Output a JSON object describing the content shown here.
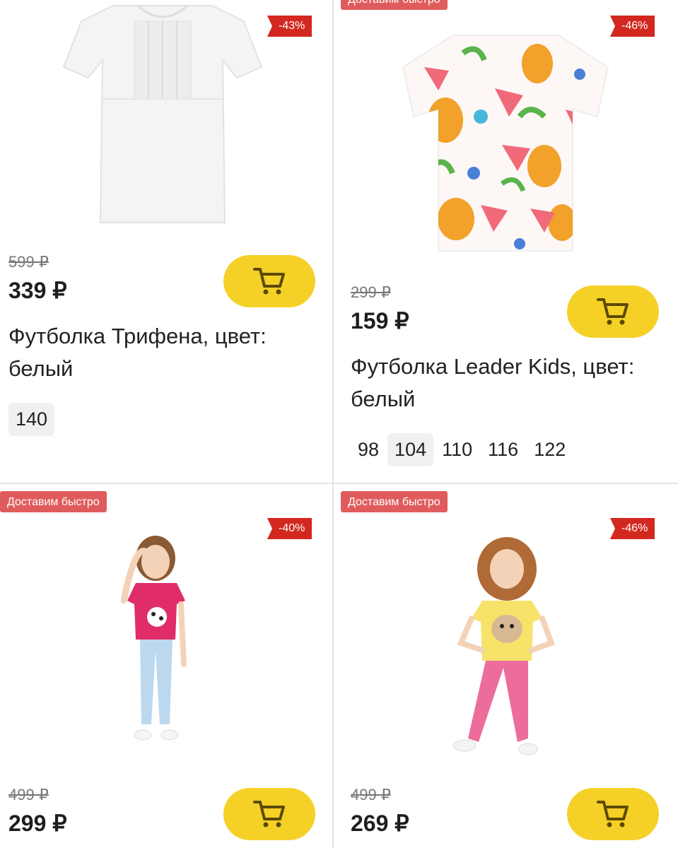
{
  "colors": {
    "cart_button": "#f5d128",
    "discount": "#d2281f",
    "fast_badge": "#e05c5c"
  },
  "products": [
    {
      "badge": "",
      "discount": "-43%",
      "old_price": "599 ₽",
      "price": "339 ₽",
      "title": "Футболка Трифена, цвет: белый",
      "sizes": [
        "140"
      ],
      "selected_size": "140",
      "image": "white-blouse"
    },
    {
      "badge": "Доставим быстро",
      "discount": "-46%",
      "old_price": "299 ₽",
      "price": "159 ₽",
      "title": "Футболка Leader Kids, цвет: белый",
      "sizes": [
        "98",
        "104",
        "110",
        "116",
        "122"
      ],
      "selected_size": "104",
      "image": "fruit-print-tshirt"
    },
    {
      "badge": "Доставим быстро",
      "discount": "-40%",
      "old_price": "499 ₽",
      "price": "299 ₽",
      "image": "girl-pink-tshirt"
    },
    {
      "badge": "Доставим быстро",
      "discount": "-46%",
      "old_price": "499 ₽",
      "price": "269 ₽",
      "image": "girl-yellow-tshirt"
    }
  ]
}
